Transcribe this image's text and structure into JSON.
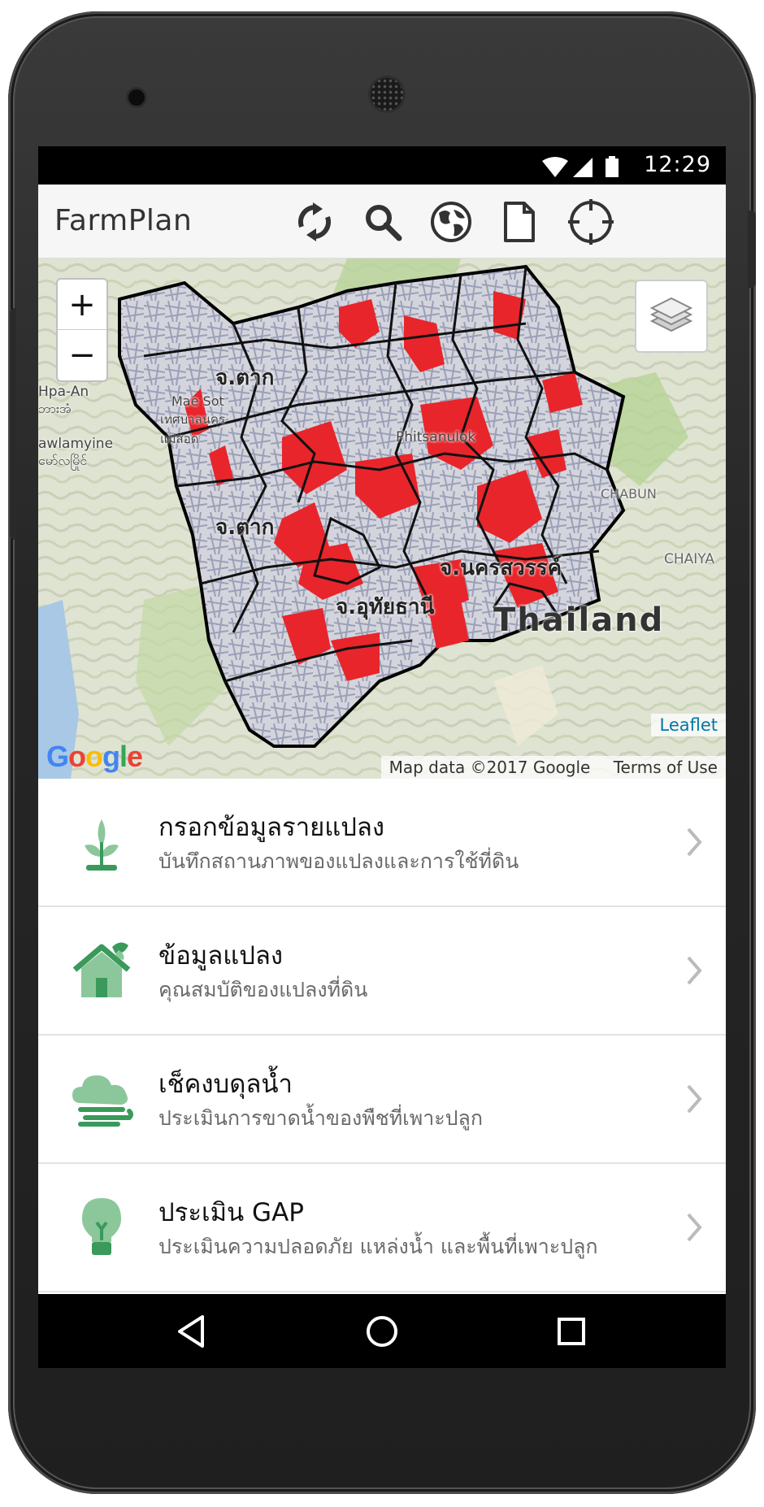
{
  "status": {
    "time": "12:29"
  },
  "app": {
    "title": "FarmPlan"
  },
  "toolbar": [
    {
      "name": "refresh-button",
      "icon": "refresh-icon"
    },
    {
      "name": "search-button",
      "icon": "search-icon"
    },
    {
      "name": "globe-button",
      "icon": "globe-icon"
    },
    {
      "name": "document-button",
      "icon": "document-icon"
    },
    {
      "name": "locate-button",
      "icon": "crosshair-icon"
    }
  ],
  "map": {
    "zoom_in": "+",
    "zoom_out": "−",
    "labels": {
      "tak1": "จ.ตาก",
      "tak2": "จ.ตาก",
      "nakhonsawan": "จ.นครสวรรค์",
      "uthai": "จ.อุทัยธานี",
      "thailand": "Thailand",
      "hpaan": "Hpa-An",
      "hpaan_my": "ဘားအံ",
      "maesot": "Mae Sot",
      "maesot_th": "เทศบาลนคร แม่สอด",
      "mawlamyine": "awlamyine",
      "mawlamyine_my": "မော်လမြိုင်",
      "phitsanulok": "Phitsanulok",
      "chaiya": "CHAIYA",
      "chabun": "CHABUN"
    },
    "attribution": {
      "leaflet": "Leaflet",
      "data": "Map data ©2017 Google",
      "terms": "Terms of Use",
      "google": "Google"
    }
  },
  "menu": [
    {
      "title": "กรอกข้อมูลรายแปลง",
      "subtitle": "บันทึกสถานภาพของแปลงและการใช้ที่ดิน",
      "icon": "sprout-icon"
    },
    {
      "title": "ข้อมูลแปลง",
      "subtitle": "คุณสมบัติของแปลงที่ดิน",
      "icon": "farmhouse-icon"
    },
    {
      "title": "เช็คงบดุลน้ำ",
      "subtitle": "ประเมินการขาดน้ำของพืชที่เพาะปลูก",
      "icon": "cloud-wind-icon"
    },
    {
      "title": "ประเมิน GAP",
      "subtitle": "ประเมินความปลอดภัย แหล่งน้ำ และพื้นที่เพาะปลูก",
      "icon": "lightbulb-icon"
    }
  ],
  "colors": {
    "accent": "#3a9a5b",
    "light_green": "#8cc79b",
    "district_fill": "#e8252b"
  }
}
